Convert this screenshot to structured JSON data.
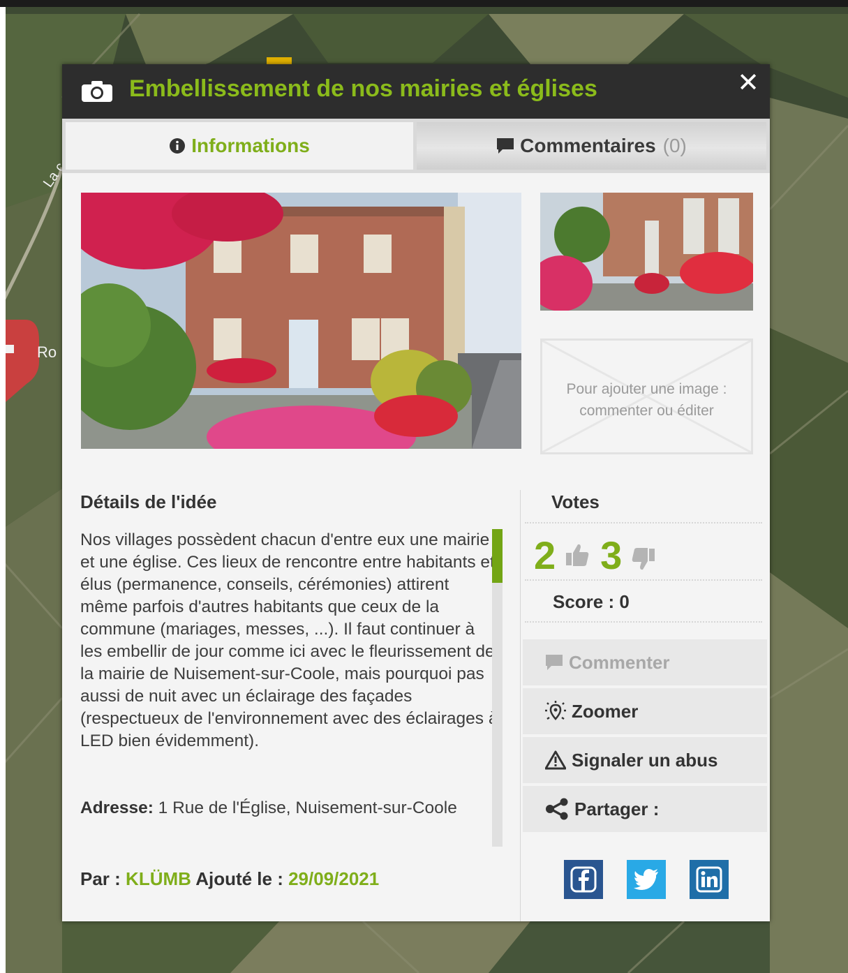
{
  "map": {
    "pin_label": "Ro",
    "road_label": "La c"
  },
  "popup": {
    "title": "Embellissement de nos mairies et églises",
    "close_symbol": "✕",
    "tabs": {
      "info_label": "Informations",
      "comments_label": "Commentaires",
      "comments_count": "(0)"
    },
    "add_image_text": "Pour ajouter une image : commenter ou éditer",
    "details": {
      "title": "Détails de l'idée",
      "text": "Nos villages possèdent chacun d'entre eux une mairie et une église. Ces lieux de rencontre entre habitants et élus (permanence, conseils, cérémonies) attirent même parfois d'autres habitants que ceux de la commune (mariages, messes, ...). Il faut continuer à les embellir de jour comme ici avec le fleurissement de la mairie de Nuisement-sur-Coole, mais pourquoi pas aussi de nuit avec un éclairage des façades (respectueux de l'environnement avec des éclairages à LED bien évidemment).",
      "scroll_fraction": 0.17,
      "address_label": "Adresse:",
      "address_value": "1 Rue de l'Église, Nuisement-sur-Coole"
    },
    "byline": {
      "by_label": "Par :",
      "author": "KLÜMB",
      "added_label": "Ajouté le :",
      "date": "29/09/2021"
    },
    "votes": {
      "title": "Votes",
      "up": "2",
      "down": "3",
      "score_label": "Score : 0"
    },
    "actions": {
      "comment": "Commenter",
      "zoom": "Zoomer",
      "report": "Signaler un abus",
      "share": "Partager :"
    },
    "social": [
      "facebook-icon",
      "twitter-icon",
      "linkedin-icon"
    ],
    "colors": {
      "accent_green": "#7fae1a",
      "header_bg": "#2d2d2d",
      "facebook": "#2a5590",
      "twitter": "#29a9e6",
      "linkedin": "#1f6ea8"
    }
  }
}
